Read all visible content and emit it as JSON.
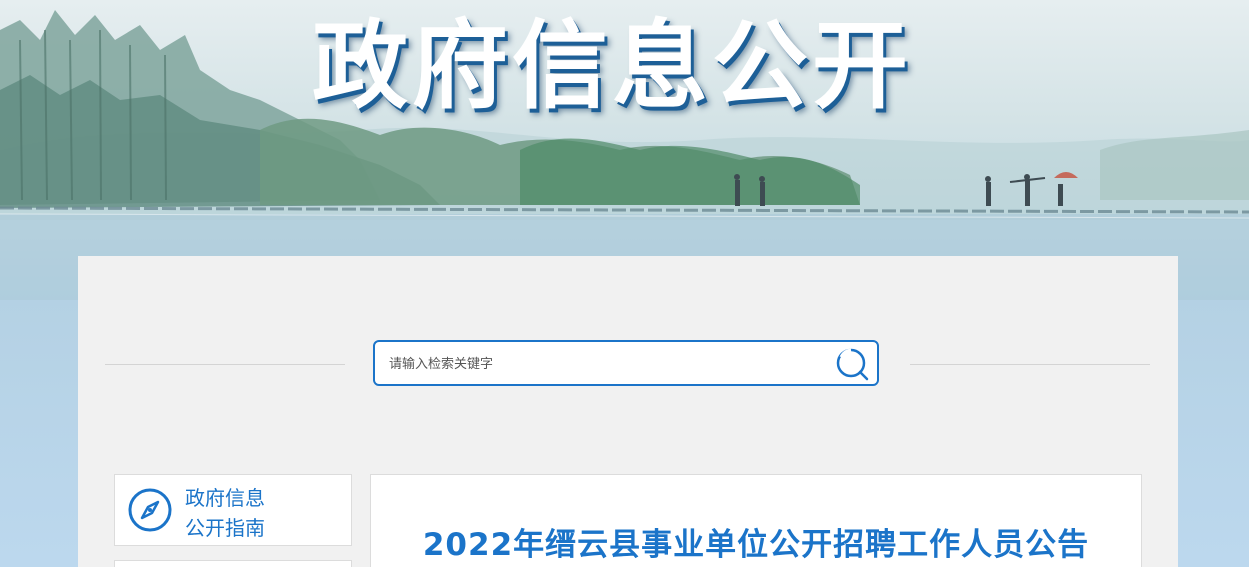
{
  "banner": {
    "title": "政府信息公开"
  },
  "search": {
    "placeholder": "请输入检索关键字",
    "icon": "search-icon"
  },
  "sidebar": {
    "guide": {
      "line1": "政府信息",
      "line2": "公开指南",
      "icon": "compass-icon"
    }
  },
  "article": {
    "title": "2022年缙云县事业单位公开招聘工作人员公告"
  },
  "colors": {
    "accent": "#1b74c9",
    "panel": "#f1f1f1",
    "title_shadow": "#1d5f97"
  }
}
